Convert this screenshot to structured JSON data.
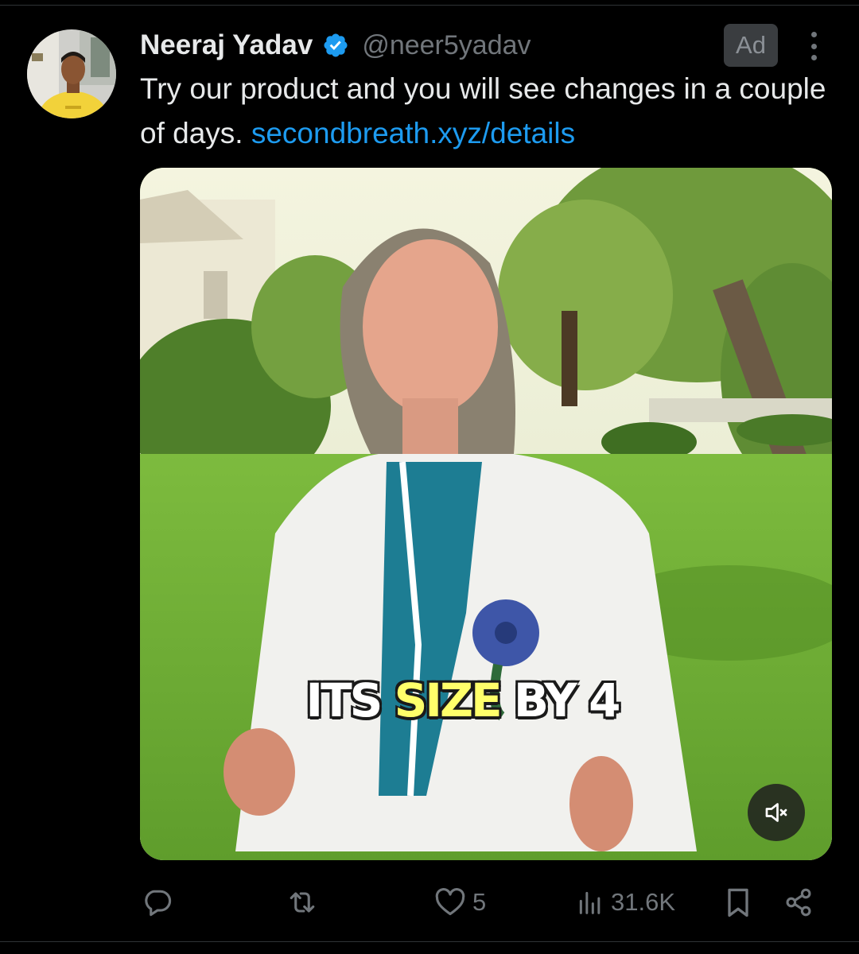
{
  "tweet": {
    "author_name": "Neeraj Yadav",
    "handle": "@neer5yadav",
    "ad_label": "Ad",
    "text": "Try our product and you will see changes in a couple of days.",
    "link": "secondbreath.xyz/details"
  },
  "media": {
    "caption_part1": "ITS",
    "caption_part2": "SIZE",
    "caption_part3": "BY 4",
    "muted": true
  },
  "actions": {
    "replies": "",
    "reposts": "",
    "likes": "5",
    "views": "31.6K"
  },
  "colors": {
    "background": "#000000",
    "link": "#1d9bf0",
    "verified": "#1d9bf0",
    "muted_text": "#71767b"
  },
  "icons": [
    "verified-badge-icon",
    "more-icon",
    "mute-icon",
    "reply-icon",
    "repost-icon",
    "like-icon",
    "views-icon",
    "bookmark-icon",
    "share-icon"
  ]
}
